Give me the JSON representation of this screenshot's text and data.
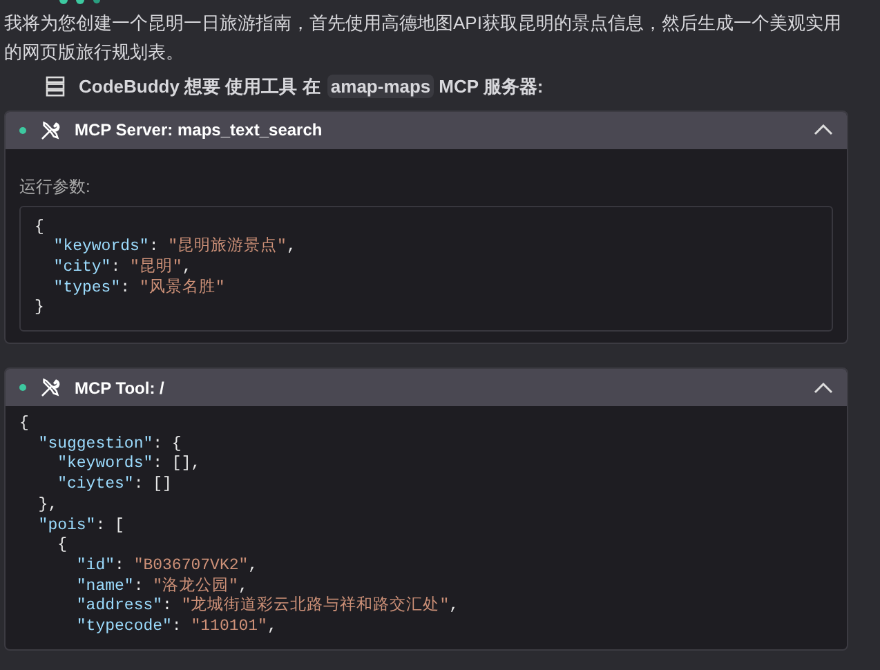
{
  "message": {
    "text": "我将为您创建一个昆明一日旅游指南，首先使用高德地图API获取昆明的景点信息，然后生成一个美观实用的网页版旅行规划表。"
  },
  "request": {
    "parts": [
      {
        "kind": "text",
        "text": "CodeBuddy 想要 使用工具 在"
      },
      {
        "kind": "chip",
        "text": "amap-maps"
      },
      {
        "kind": "text",
        "text": "MCP 服务器:"
      }
    ]
  },
  "panels": [
    {
      "title": "MCP Server: maps_text_search",
      "expanded": true,
      "label": "运行参数:",
      "lines": [
        [
          {
            "kind": "punct",
            "text": "{"
          }
        ],
        [
          {
            "kind": "key",
            "text": "  \"keywords\""
          },
          {
            "kind": "punct",
            "text": ": "
          },
          {
            "kind": "string",
            "text": "\"昆明旅游景点\""
          },
          {
            "kind": "punct",
            "text": ","
          }
        ],
        [
          {
            "kind": "key",
            "text": "  \"city\""
          },
          {
            "kind": "punct",
            "text": ": "
          },
          {
            "kind": "string",
            "text": "\"昆明\""
          },
          {
            "kind": "punct",
            "text": ","
          }
        ],
        [
          {
            "kind": "key",
            "text": "  \"types\""
          },
          {
            "kind": "punct",
            "text": ": "
          },
          {
            "kind": "string",
            "text": "\"风景名胜\""
          }
        ],
        [
          {
            "kind": "punct",
            "text": "}"
          }
        ]
      ]
    },
    {
      "title": "MCP Tool: /",
      "expanded": true,
      "lines": [
        [
          {
            "kind": "punct",
            "text": "{"
          }
        ],
        [
          {
            "kind": "key",
            "text": "  \"suggestion\""
          },
          {
            "kind": "punct",
            "text": ": {"
          }
        ],
        [
          {
            "kind": "key",
            "text": "    \"keywords\""
          },
          {
            "kind": "punct",
            "text": ": [],"
          }
        ],
        [
          {
            "kind": "key",
            "text": "    \"ciytes\""
          },
          {
            "kind": "punct",
            "text": ": []"
          }
        ],
        [
          {
            "kind": "punct",
            "text": "  },"
          }
        ],
        [
          {
            "kind": "key",
            "text": "  \"pois\""
          },
          {
            "kind": "punct",
            "text": ": ["
          }
        ],
        [
          {
            "kind": "punct",
            "text": "    {"
          }
        ],
        [
          {
            "kind": "key",
            "text": "      \"id\""
          },
          {
            "kind": "punct",
            "text": ": "
          },
          {
            "kind": "string",
            "text": "\"B036707VK2\""
          },
          {
            "kind": "punct",
            "text": ","
          }
        ],
        [
          {
            "kind": "key",
            "text": "      \"name\""
          },
          {
            "kind": "punct",
            "text": ": "
          },
          {
            "kind": "string",
            "text": "\"洛龙公园\""
          },
          {
            "kind": "punct",
            "text": ","
          }
        ],
        [
          {
            "kind": "key",
            "text": "      \"address\""
          },
          {
            "kind": "punct",
            "text": ": "
          },
          {
            "kind": "string",
            "text": "\"龙城街道彩云北路与祥和路交汇处\""
          },
          {
            "kind": "punct",
            "text": ","
          }
        ],
        [
          {
            "kind": "key",
            "text": "      \"typecode\""
          },
          {
            "kind": "punct",
            "text": ": "
          },
          {
            "kind": "string",
            "text": "\"110101\""
          },
          {
            "kind": "punct",
            "text": ","
          }
        ]
      ]
    }
  ]
}
